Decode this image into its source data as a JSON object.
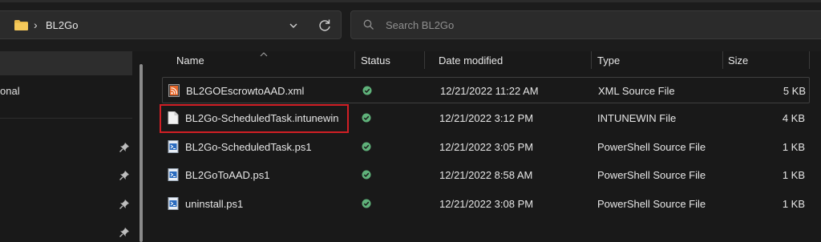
{
  "address": {
    "breadcrumb_sep": "›",
    "folder": "BL2Go"
  },
  "search": {
    "placeholder": "Search BL2Go"
  },
  "sidebar": {
    "partial_label": "onal"
  },
  "columns": {
    "name": "Name",
    "status": "Status",
    "date": "Date modified",
    "type": "Type",
    "size": "Size"
  },
  "files": [
    {
      "name": "BL2GOEscrowtoAAD.xml",
      "icon": "xml-file-icon",
      "status": "synced",
      "date": "12/21/2022 11:22 AM",
      "type": "XML Source File",
      "size": "5 KB"
    },
    {
      "name": "BL2Go-ScheduledTask.intunewin",
      "icon": "blank-file-icon",
      "status": "synced",
      "date": "12/21/2022 3:12 PM",
      "type": "INTUNEWIN File",
      "size": "4 KB"
    },
    {
      "name": "BL2Go-ScheduledTask.ps1",
      "icon": "powershell-file-icon",
      "status": "synced",
      "date": "12/21/2022 3:05 PM",
      "type": "PowerShell Source File",
      "size": "1 KB"
    },
    {
      "name": "BL2GoToAAD.ps1",
      "icon": "powershell-file-icon",
      "status": "synced",
      "date": "12/21/2022 8:58 AM",
      "type": "PowerShell Source File",
      "size": "1 KB"
    },
    {
      "name": "uninstall.ps1",
      "icon": "powershell-file-icon",
      "status": "synced",
      "date": "12/21/2022 3:08 PM",
      "type": "PowerShell Source File",
      "size": "1 KB"
    }
  ],
  "colors": {
    "highlight_box": "#d11f25",
    "status_ok": "#5fb27a",
    "folder": "#e8b94a"
  }
}
